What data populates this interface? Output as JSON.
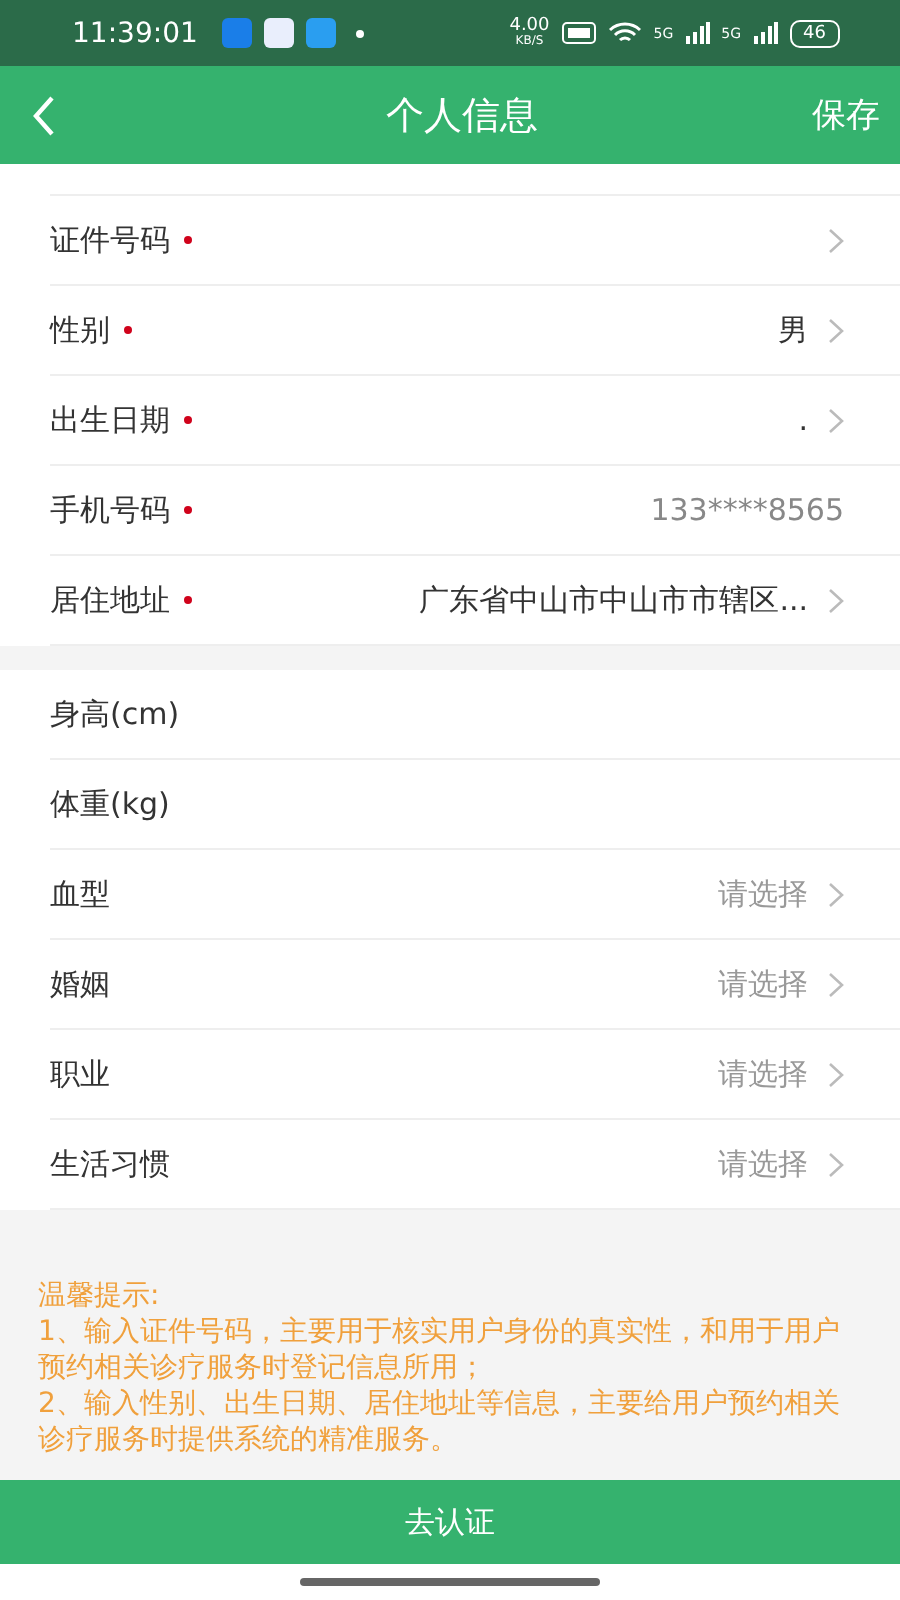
{
  "status_bar": {
    "time": "11:39:01",
    "speed": "4.00",
    "speed_unit": "KB/S",
    "network_1": "5G",
    "network_2": "5G",
    "battery": "46"
  },
  "header": {
    "title": "个人信息",
    "action": "保存"
  },
  "sections": [
    {
      "rows": [
        {
          "label": "证件号码",
          "required": true,
          "arrow": true
        },
        {
          "label": "性别",
          "required": true,
          "value": "男",
          "arrow": true
        },
        {
          "label": "出生日期",
          "required": true,
          "value": ".",
          "arrow": true
        },
        {
          "label": "手机号码",
          "required": true,
          "value": "133****8565",
          "muted": true,
          "arrow": false
        },
        {
          "label": "居住地址",
          "required": true,
          "value": "广东省中山市中山市市辖区...",
          "arrow": true
        }
      ]
    },
    {
      "rows": [
        {
          "label": "身高(cm)",
          "required": false,
          "arrow": false
        },
        {
          "label": "体重(kg)",
          "required": false,
          "arrow": false
        },
        {
          "label": "血型",
          "required": false,
          "placeholder": "请选择",
          "arrow": true
        },
        {
          "label": "婚姻",
          "required": false,
          "placeholder": "请选择",
          "arrow": true
        },
        {
          "label": "职业",
          "required": false,
          "placeholder": "请选择",
          "arrow": true
        },
        {
          "label": "生活习惯",
          "required": false,
          "placeholder": "请选择",
          "arrow": true
        }
      ]
    }
  ],
  "notice": {
    "title": "温馨提示:",
    "lines": [
      "1、输入证件号码，主要用于核实用户身份的真实性，和用于用户预约相关诊疗服务时登记信息所用；",
      "2、输入性别、出生日期、居住地址等信息，主要给用户预约相关诊疗服务时提供系统的精准服务。"
    ]
  },
  "button": "去认证"
}
